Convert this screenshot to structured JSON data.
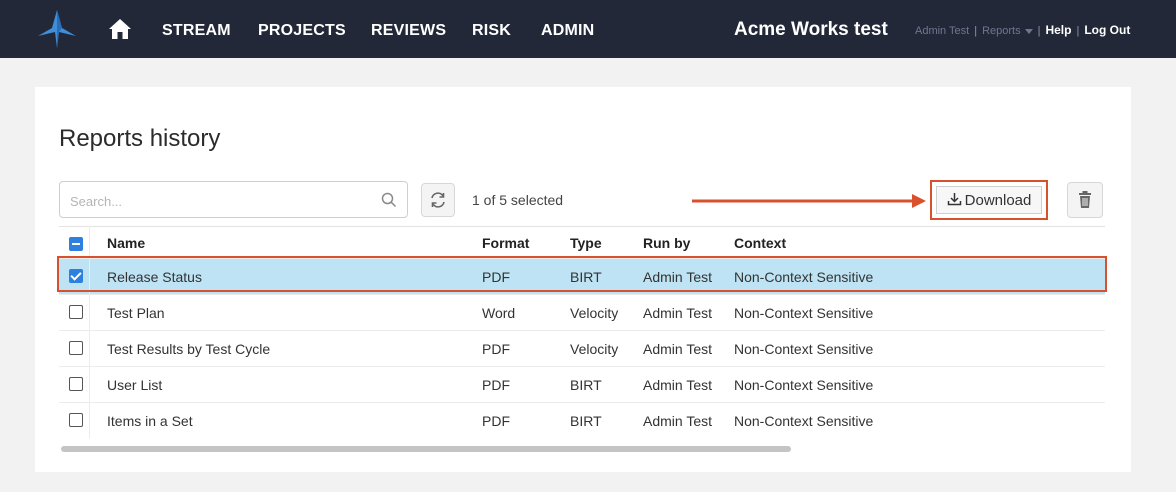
{
  "header": {
    "nav": [
      "STREAM",
      "PROJECTS",
      "REVIEWS",
      "RISK",
      "ADMIN"
    ],
    "app_title": "Acme Works test",
    "user": "Admin Test",
    "reports_menu": "Reports",
    "help": "Help",
    "logout": "Log Out",
    "icons": {
      "logo": "app-logo",
      "home": "home-icon"
    }
  },
  "page": {
    "title": "Reports history"
  },
  "toolbar": {
    "search_placeholder": "Search...",
    "search_value": "",
    "selection_status": "1 of 5 selected",
    "download_label": "Download"
  },
  "table": {
    "columns": [
      "Name",
      "Format",
      "Type",
      "Run by",
      "Context"
    ],
    "rows": [
      {
        "checked": true,
        "name": "Release Status",
        "format": "PDF",
        "type": "BIRT",
        "run_by": "Admin Test",
        "context": "Non-Context Sensitive"
      },
      {
        "checked": false,
        "name": "Test Plan",
        "format": "Word",
        "type": "Velocity",
        "run_by": "Admin Test",
        "context": "Non-Context Sensitive"
      },
      {
        "checked": false,
        "name": "Test Results by Test Cycle",
        "format": "PDF",
        "type": "Velocity",
        "run_by": "Admin Test",
        "context": "Non-Context Sensitive"
      },
      {
        "checked": false,
        "name": "User List",
        "format": "PDF",
        "type": "BIRT",
        "run_by": "Admin Test",
        "context": "Non-Context Sensitive"
      },
      {
        "checked": false,
        "name": "Items in a Set",
        "format": "PDF",
        "type": "BIRT",
        "run_by": "Admin Test",
        "context": "Non-Context Sensitive"
      }
    ]
  },
  "colors": {
    "nav_bg": "#232838",
    "highlight": "#d9502d",
    "selected_row": "#bde3f4",
    "checkbox": "#2d7fe0"
  }
}
